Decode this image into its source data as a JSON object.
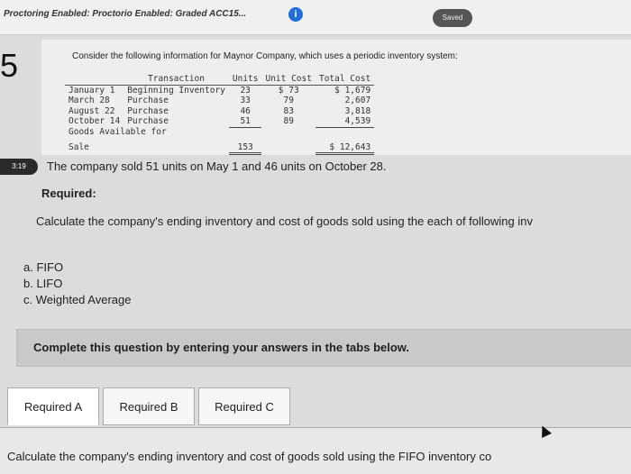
{
  "header": {
    "proctor_text": "Proctoring Enabled: Proctorio Enabled: Graded ACC15...",
    "info_icon": "i",
    "saved_label": "Saved"
  },
  "question": {
    "number": "5",
    "intro": "Consider the following information for Maynor Company, which uses a periodic inventory system:",
    "table": {
      "headers": [
        "Transaction",
        "Units",
        "Unit Cost",
        "Total Cost"
      ],
      "rows": [
        {
          "date": "January 1",
          "transaction": "Beginning Inventory",
          "units": "23",
          "unit_cost": "$ 73",
          "total_cost": "$ 1,679"
        },
        {
          "date": "March 28",
          "transaction": "Purchase",
          "units": "33",
          "unit_cost": "79",
          "total_cost": "2,607"
        },
        {
          "date": "August 22",
          "transaction": "Purchase",
          "units": "46",
          "unit_cost": "83",
          "total_cost": "3,818"
        },
        {
          "date": "October 14",
          "transaction": "Purchase",
          "units": "51",
          "unit_cost": "89",
          "total_cost": "4,539"
        }
      ],
      "total_label_1": "Goods Available for",
      "total_label_2": "Sale",
      "total_units": "153",
      "total_cost": "$ 12,643"
    },
    "timer": "3:19",
    "sold_text": "The company sold 51 units on May 1 and 46 units on October 28.",
    "required_heading": "Required:",
    "calc_text": "Calculate the company's ending inventory and cost of goods sold using the each of following inv",
    "options": [
      "a. FIFO",
      "b. LIFO",
      "c. Weighted Average"
    ]
  },
  "complete_banner": "Complete this question by entering your answers in the tabs below.",
  "tabs": [
    "Required A",
    "Required B",
    "Required C"
  ],
  "tab_body_text": "Calculate the company's ending inventory and cost of goods sold using the FIFO inventory co"
}
